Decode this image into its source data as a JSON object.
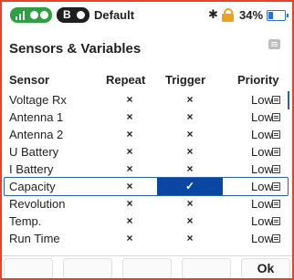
{
  "status": {
    "model_name": "Default",
    "mode_label": "B",
    "battery_percent": "34%",
    "bluetooth_icon": "bluetooth-icon",
    "lock_icon": "lock-icon",
    "signal_icon": "signal-icon"
  },
  "page": {
    "title": "Sensors & Variables",
    "menu_icon": "menu-icon"
  },
  "table": {
    "headers": {
      "sensor": "Sensor",
      "repeat": "Repeat",
      "trigger": "Trigger",
      "priority": "Priority"
    },
    "rows": [
      {
        "sensor": "Voltage Rx",
        "repeat": "×",
        "trigger": "×",
        "priority": "Low",
        "selected": false
      },
      {
        "sensor": "Antenna 1",
        "repeat": "×",
        "trigger": "×",
        "priority": "Low",
        "selected": false
      },
      {
        "sensor": "Antenna 2",
        "repeat": "×",
        "trigger": "×",
        "priority": "Low",
        "selected": false
      },
      {
        "sensor": "U Battery",
        "repeat": "×",
        "trigger": "×",
        "priority": "Low",
        "selected": false
      },
      {
        "sensor": "I Battery",
        "repeat": "×",
        "trigger": "×",
        "priority": "Low",
        "selected": false
      },
      {
        "sensor": "Capacity",
        "repeat": "×",
        "trigger": "✓",
        "priority": "Low",
        "selected": true
      },
      {
        "sensor": "Revolution",
        "repeat": "×",
        "trigger": "×",
        "priority": "Low",
        "selected": false
      },
      {
        "sensor": "Temp.",
        "repeat": "×",
        "trigger": "×",
        "priority": "Low",
        "selected": false
      },
      {
        "sensor": "Run Time",
        "repeat": "×",
        "trigger": "×",
        "priority": "Low",
        "selected": false
      }
    ]
  },
  "footer": {
    "ok_label": "Ok"
  },
  "colors": {
    "accent": "#0a47a3",
    "frame": "#e8432a",
    "signal": "#2ea043",
    "lock": "#f0a020",
    "battery": "#2f6fd0"
  }
}
